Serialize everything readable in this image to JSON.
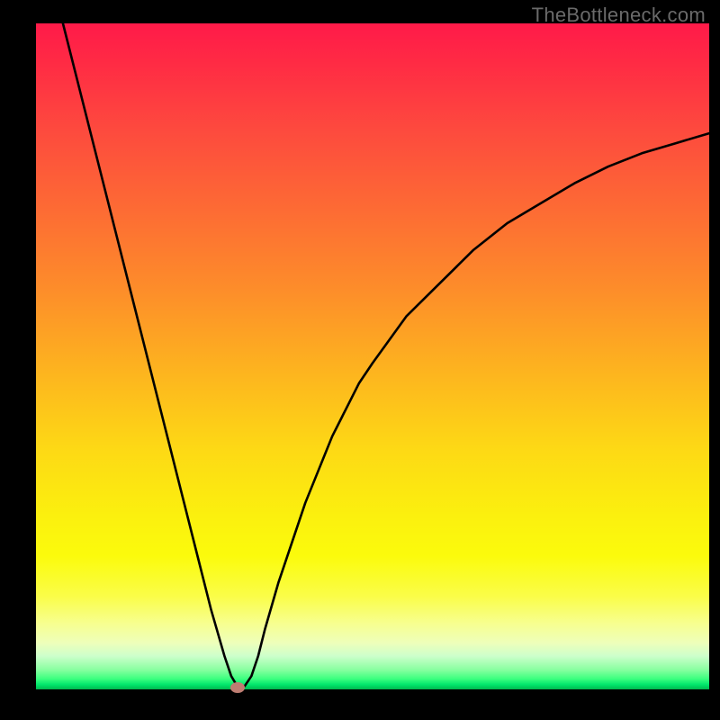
{
  "watermark": "TheBottleneck.com",
  "chart_data": {
    "type": "line",
    "title": "",
    "xlabel": "",
    "ylabel": "",
    "xlim": [
      0,
      100
    ],
    "ylim": [
      0,
      100
    ],
    "grid": false,
    "series": [
      {
        "name": "bottleneck-curve",
        "x": [
          4,
          6,
          8,
          10,
          12,
          14,
          16,
          18,
          20,
          22,
          24,
          26,
          28,
          29,
          30,
          31,
          32,
          33,
          34,
          36,
          38,
          40,
          42,
          44,
          46,
          48,
          50,
          55,
          60,
          65,
          70,
          75,
          80,
          85,
          90,
          95,
          100
        ],
        "y": [
          100,
          92,
          84,
          76,
          68,
          60,
          52,
          44,
          36,
          28,
          20,
          12,
          5,
          2,
          0.3,
          0.5,
          2,
          5,
          9,
          16,
          22,
          28,
          33,
          38,
          42,
          46,
          49,
          56,
          61,
          66,
          70,
          73,
          76,
          78.5,
          80.5,
          82,
          83.5
        ]
      }
    ],
    "annotations": [
      {
        "name": "min-marker",
        "x": 30,
        "y": 0.3
      }
    ],
    "background_gradient": {
      "top": "#ff1a49",
      "upper_mid": "#fdb31f",
      "lower_mid": "#fbfb0c",
      "bottom": "#00b74e"
    }
  }
}
